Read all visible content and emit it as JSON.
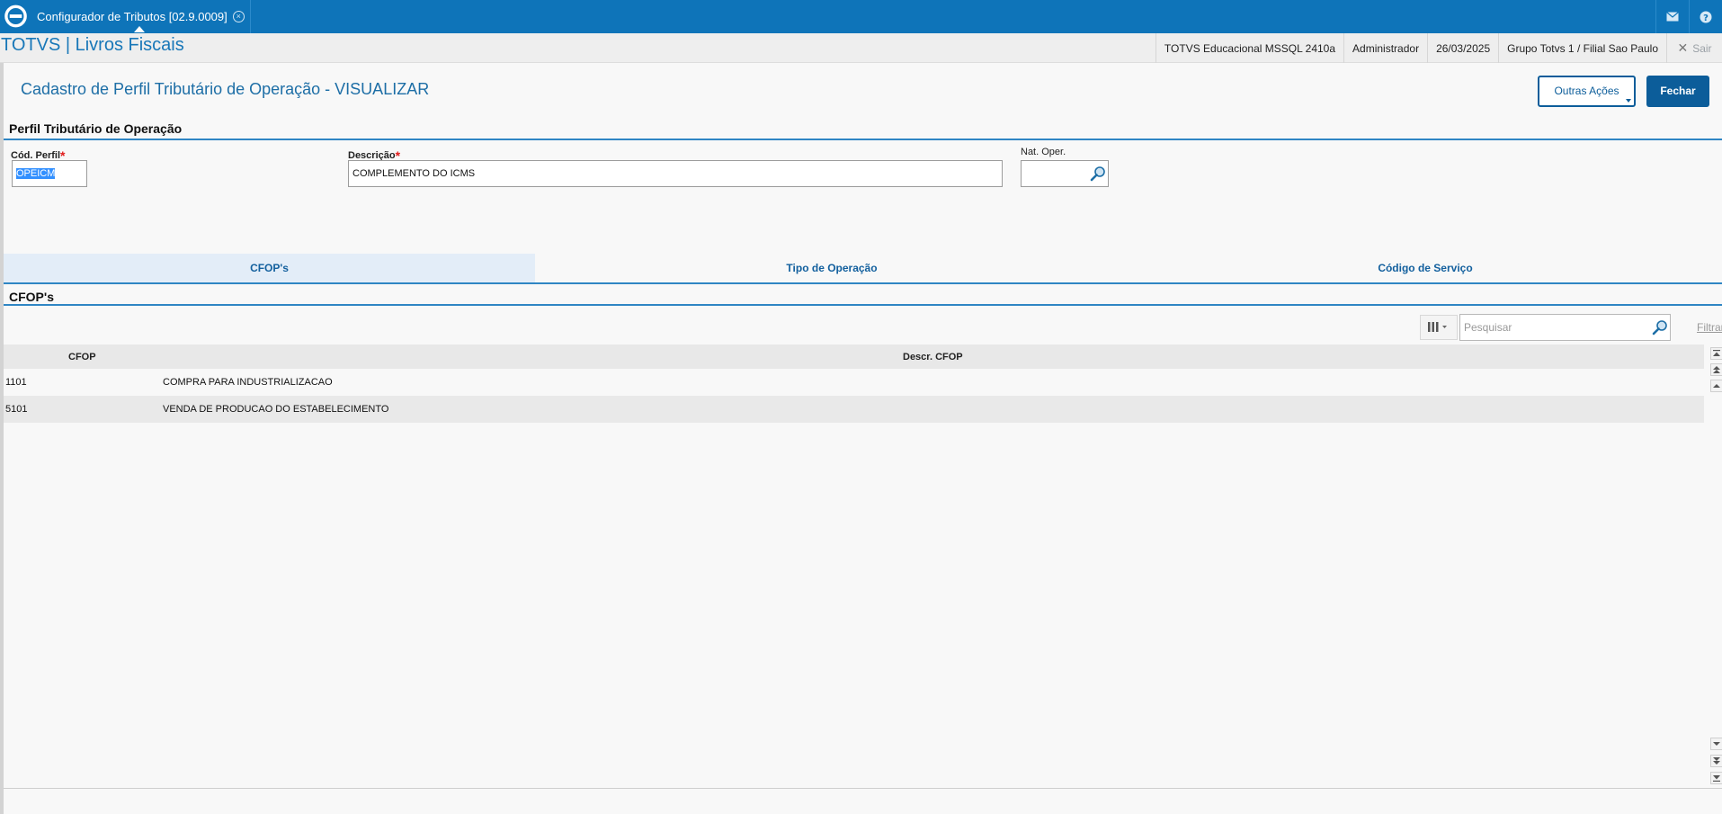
{
  "window": {
    "tab_title": "Configurador de Tributos [02.9.0009]",
    "tab_close_glyph": "×",
    "mail_icon": "mail-icon",
    "help_icon": "help-icon"
  },
  "appbar": {
    "title": "TOTVS | Livros Fiscais",
    "environment": "TOTVS Educacional MSSQL 2410a",
    "user": "Administrador",
    "date": "26/03/2025",
    "company": "Grupo Totvs 1 / Filial Sao Paulo",
    "exit_label": "Sair"
  },
  "page": {
    "title": "Cadastro de Perfil Tributário de Operação - VISUALIZAR",
    "other_actions_label": "Outras Ações",
    "close_label": "Fechar"
  },
  "form": {
    "section_title": "Perfil Tributário de Operação",
    "cod_perfil": {
      "label": "Cód. Perfil",
      "required": "*",
      "value": "OPEICM"
    },
    "descricao": {
      "label": "Descrição",
      "required": "*",
      "value": "COMPLEMENTO DO ICMS"
    },
    "nat_oper": {
      "label": "Nat. Oper.",
      "value": ""
    }
  },
  "tabs": [
    {
      "label": "CFOP's",
      "active": true
    },
    {
      "label": "Tipo de Operação",
      "active": false
    },
    {
      "label": "Código de Serviço",
      "active": false
    }
  ],
  "grid": {
    "section_title": "CFOP's",
    "search_placeholder": "Pesquisar",
    "filter_label": "Filtrar",
    "columns": [
      "CFOP",
      "Descr. CFOP"
    ],
    "rows": [
      {
        "cfop": "1101",
        "descricao": "COMPRA PARA INDUSTRIALIZACAO"
      },
      {
        "cfop": "5101",
        "descricao": "VENDA DE PRODUCAO DO ESTABELECIMENTO"
      }
    ]
  },
  "colors": {
    "topbar": "#0e74b9",
    "accent": "#2f86c4",
    "button_primary": "#0c5d9a",
    "required": "#e11b1b"
  }
}
